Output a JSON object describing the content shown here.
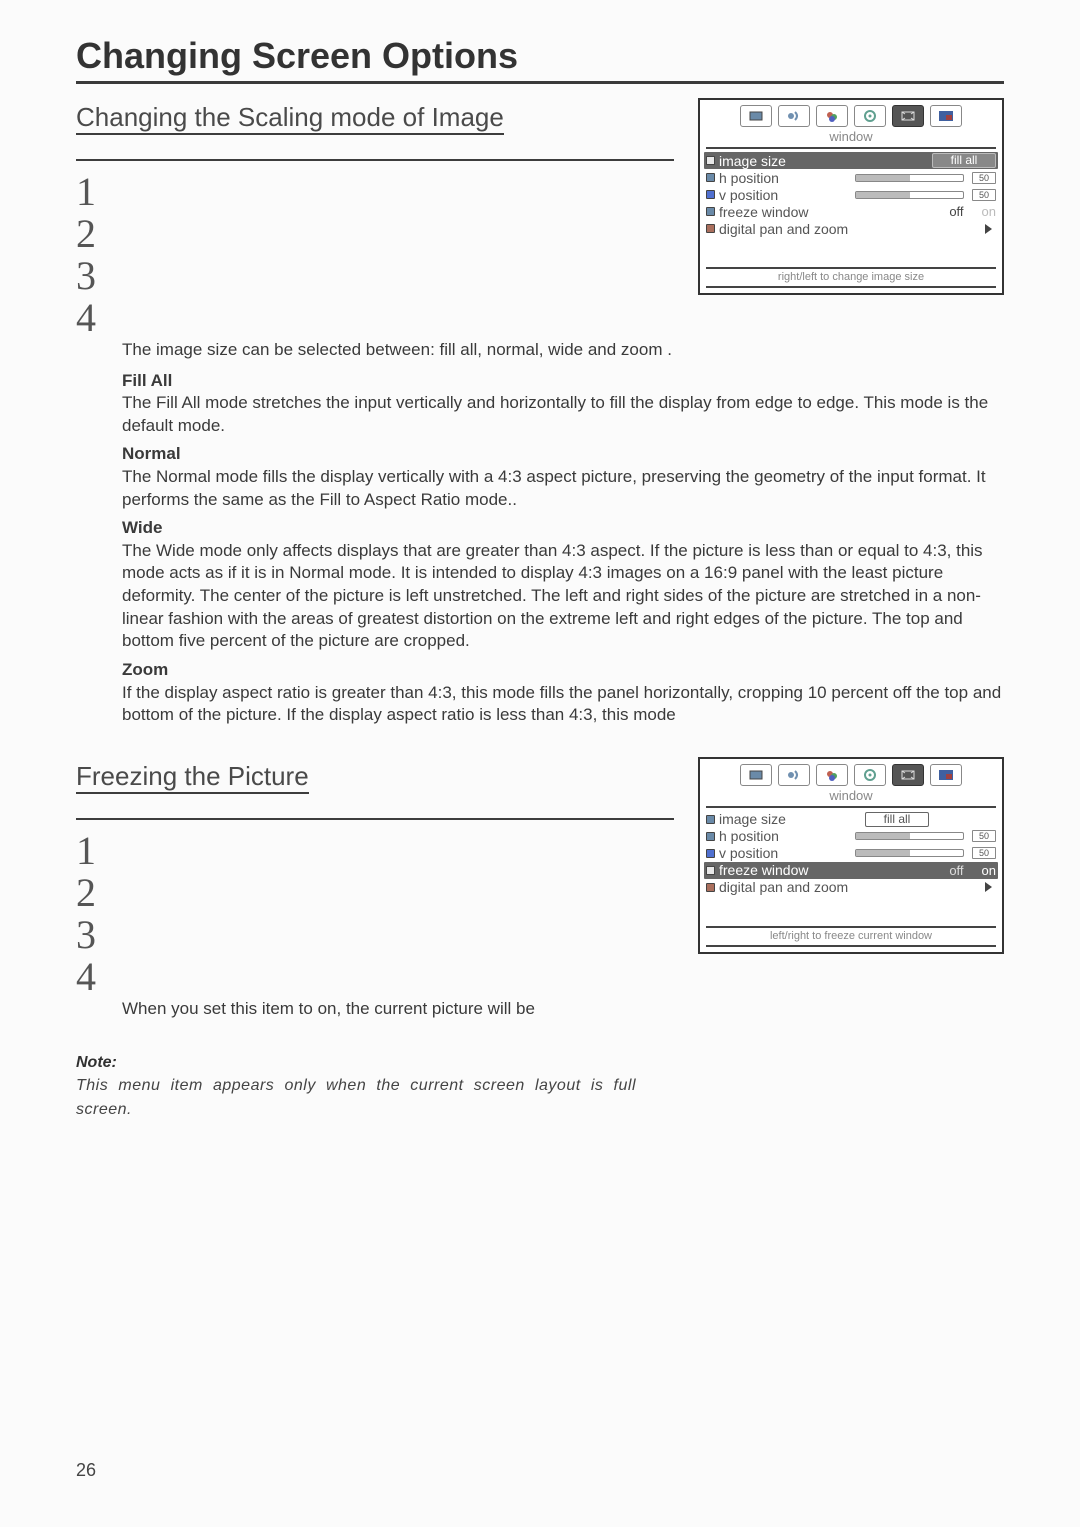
{
  "page_title": "Changing Screen Options",
  "page_number": "26",
  "section1": {
    "title": "Changing the Scaling mode of Image",
    "steps": [
      "1",
      "2",
      "3",
      "4"
    ],
    "intro": "The image size can be selected between: fill all, normal, wide and zoom .",
    "modes": {
      "fill_all_name": "Fill All",
      "fill_all_body": "The Fill All mode stretches the input vertically and horizontally to fill the display from edge to edge. This mode is the default mode.",
      "normal_name": "Normal",
      "normal_body": "The Normal mode fills the display vertically with a 4:3 aspect picture, preserving the geometry of the input format. It performs the same as the Fill to Aspect Ratio mode..",
      "wide_name": "Wide",
      "wide_body": "The Wide mode only affects displays that are greater than 4:3 aspect. If the picture is less than or equal to 4:3, this mode acts as if it is in Normal mode. It is intended to display 4:3 images on a 16:9 panel with the least picture deformity. The center of the picture is left unstretched. The left and right sides of the picture are stretched in a non-linear fashion with the areas of greatest distortion on the extreme left and right edges of the picture. The top and bottom five percent of the picture are cropped.",
      "zoom_name": "Zoom",
      "zoom_body": "If the display aspect ratio is greater than 4:3, this mode fills the panel horizontally, cropping 10 percent off the top and bottom of the picture. If the display aspect ratio is less than 4:3, this mode"
    }
  },
  "section2": {
    "title": "Freezing the Picture",
    "steps": [
      "1",
      "2",
      "3",
      "4"
    ],
    "body": "When you set this item to on, the current picture will be",
    "note_label": "Note:",
    "note_text": "This menu item appears  only when the current screen layout is full screen."
  },
  "osd1": {
    "tab_title": "window",
    "rows": {
      "image_size": {
        "label": "image size",
        "value": "fill all",
        "selected": true
      },
      "h_position": {
        "label": "h position",
        "value": "50"
      },
      "v_position": {
        "label": "v position",
        "value": "50"
      },
      "freeze": {
        "label": "freeze window",
        "off": "off",
        "on": "on",
        "selected_on": false
      },
      "zoom": {
        "label": "digital pan and zoom"
      }
    },
    "hint": "right/left to change image size"
  },
  "osd2": {
    "tab_title": "window",
    "rows": {
      "image_size": {
        "label": "image size",
        "value": "fill all"
      },
      "h_position": {
        "label": "h position",
        "value": "50"
      },
      "v_position": {
        "label": "v position",
        "value": "50"
      },
      "freeze": {
        "label": "freeze window",
        "off": "off",
        "on": "on",
        "selected": true,
        "selected_on": true
      },
      "zoom": {
        "label": "digital pan and zoom"
      }
    },
    "hint": "left/right to freeze current window"
  }
}
